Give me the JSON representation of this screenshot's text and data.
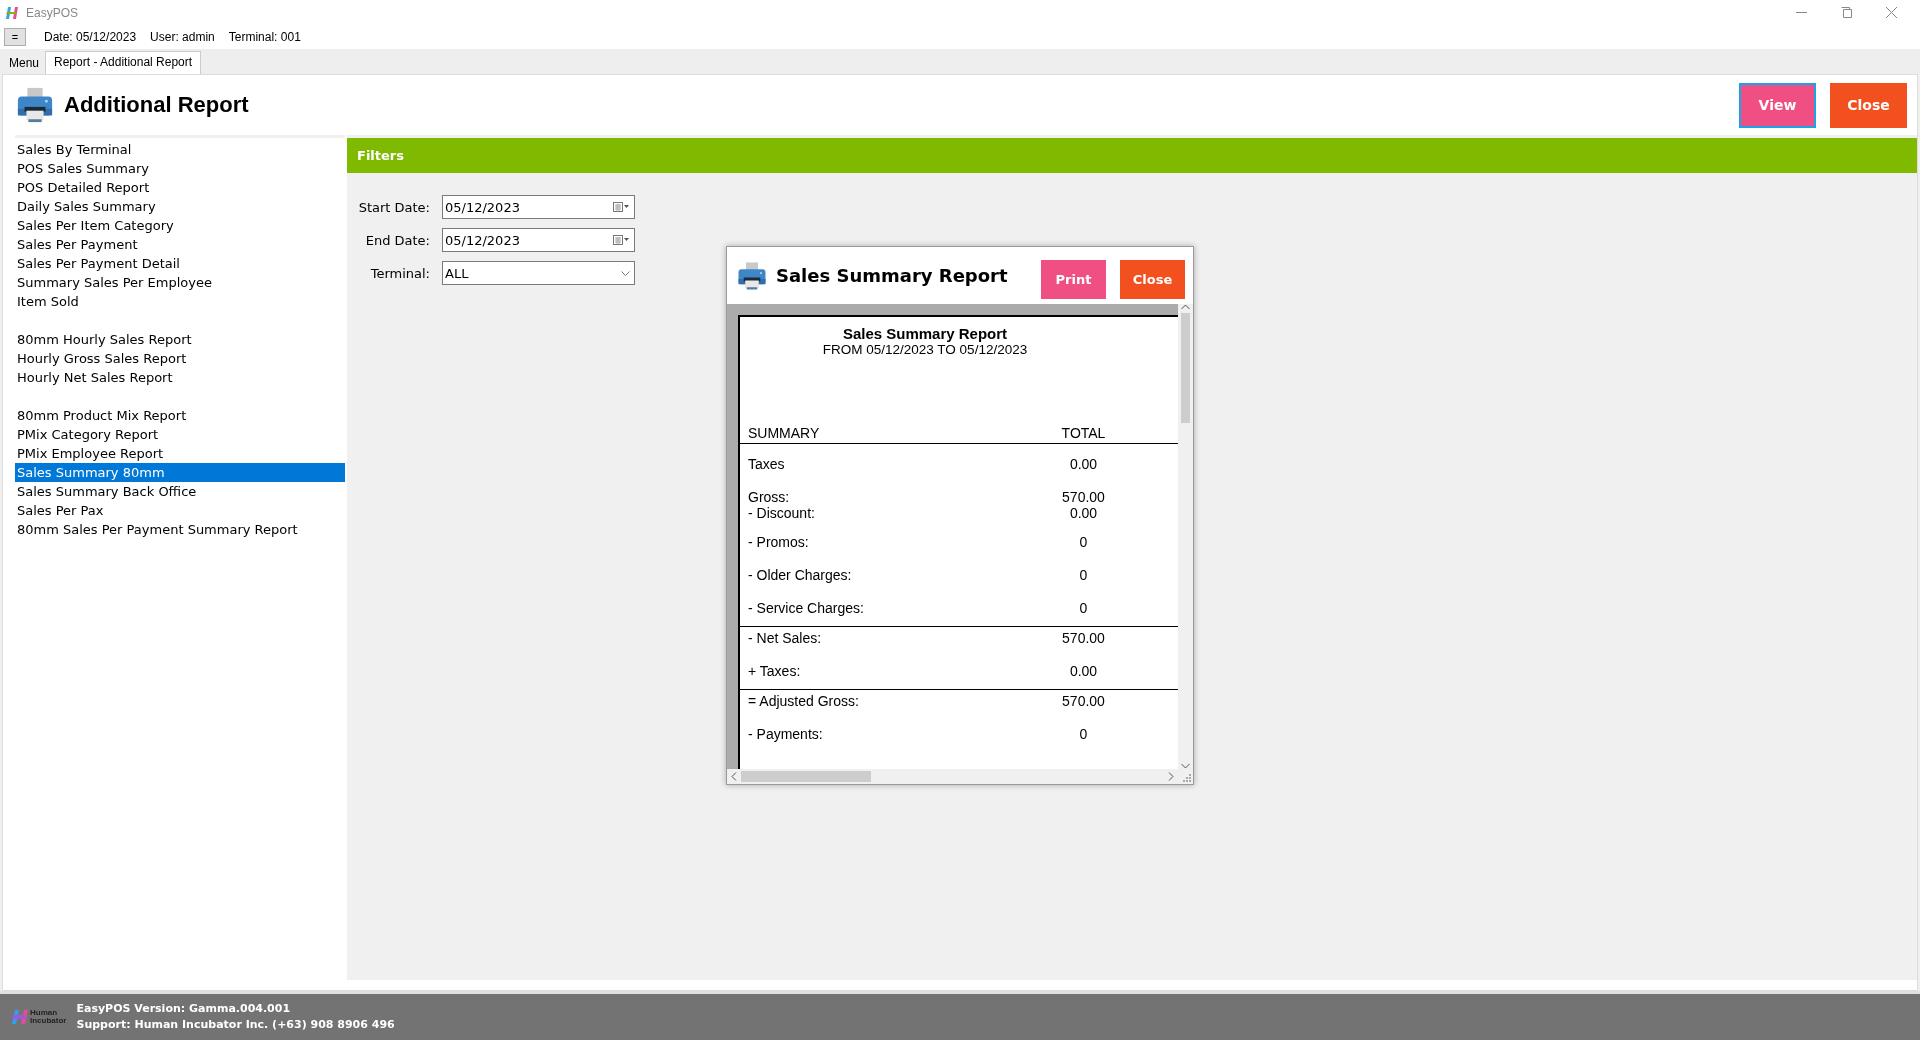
{
  "window": {
    "title": "EasyPOS"
  },
  "info_bar": {
    "menu_button": "=",
    "date": "Date: 05/12/2023",
    "user": "User: admin",
    "terminal": "Terminal: 001"
  },
  "tabs": [
    {
      "label": "Menu",
      "selected": false
    },
    {
      "label": "Report - Additional Report",
      "selected": true
    }
  ],
  "page": {
    "title": "Additional Report",
    "buttons": [
      {
        "label": "View",
        "kind": "view",
        "focused": true
      },
      {
        "label": "Close",
        "kind": "close",
        "focused": false
      }
    ]
  },
  "report_list": [
    [
      {
        "label": "Sales By Terminal",
        "selected": false
      },
      {
        "label": "POS Sales Summary",
        "selected": false
      },
      {
        "label": "POS Detailed Report",
        "selected": false
      },
      {
        "label": "Daily Sales Summary",
        "selected": false
      },
      {
        "label": "Sales Per Item Category",
        "selected": false
      },
      {
        "label": "Sales Per Payment",
        "selected": false
      },
      {
        "label": "Sales Per Payment Detail",
        "selected": false
      },
      {
        "label": "Summary Sales Per Employee",
        "selected": false
      },
      {
        "label": "Item Sold",
        "selected": false
      }
    ],
    [
      {
        "label": "80mm Hourly Sales Report",
        "selected": false
      },
      {
        "label": "Hourly Gross Sales Report",
        "selected": false
      },
      {
        "label": "Hourly Net Sales Report",
        "selected": false
      }
    ],
    [
      {
        "label": "80mm Product Mix Report",
        "selected": false
      },
      {
        "label": "PMix Category Report",
        "selected": false
      },
      {
        "label": "PMix Employee Report",
        "selected": false
      },
      {
        "label": "Sales Summary 80mm",
        "selected": true
      },
      {
        "label": "Sales Summary Back Office",
        "selected": false
      },
      {
        "label": "Sales Per Pax",
        "selected": false
      },
      {
        "label": "80mm Sales Per Payment Summary Report",
        "selected": false
      }
    ]
  ],
  "filters": {
    "title": "Filters",
    "fields": [
      {
        "label": "Start Date:",
        "value": "05/12/2023",
        "kind": "date"
      },
      {
        "label": "End Date:",
        "value": "05/12/2023",
        "kind": "date"
      },
      {
        "label": "Terminal:",
        "value": "ALL",
        "kind": "select"
      }
    ]
  },
  "dialog": {
    "title": "Sales Summary Report",
    "buttons": [
      {
        "label": "Print",
        "kind": "print"
      },
      {
        "label": "Close",
        "kind": "close"
      }
    ],
    "report": {
      "title": "Sales Summary Report",
      "subtitle": "FROM 05/12/2023 TO 05/12/2023",
      "columns": [
        "SUMMARY",
        "TOTAL"
      ],
      "rows": [
        {
          "rule_above": false,
          "lines": [
            {
              "label": "Taxes",
              "total": "0.00"
            }
          ]
        },
        {
          "rule_above": false,
          "lines": [
            {
              "label": "Gross:",
              "total": "570.00"
            },
            {
              "label": "- Discount:",
              "total": "0.00"
            }
          ]
        },
        {
          "rule_above": false,
          "lines": [
            {
              "label": "- Promos:",
              "total": "0"
            }
          ]
        },
        {
          "rule_above": false,
          "lines": [
            {
              "label": "- Older Charges:",
              "total": "0"
            }
          ]
        },
        {
          "rule_above": false,
          "lines": [
            {
              "label": "- Service Charges:",
              "total": "0"
            }
          ]
        },
        {
          "rule_above": true,
          "lines": [
            {
              "label": "- Net Sales:",
              "total": "570.00"
            }
          ]
        },
        {
          "rule_above": false,
          "lines": [
            {
              "label": "+ Taxes:",
              "total": "0.00"
            }
          ]
        },
        {
          "rule_above": true,
          "lines": [
            {
              "label": "= Adjusted Gross:",
              "total": "570.00"
            }
          ]
        },
        {
          "rule_above": false,
          "lines": [
            {
              "label": "- Payments:",
              "total": "0"
            }
          ]
        }
      ]
    }
  },
  "footer": {
    "logo_text": [
      "Human",
      "Incubator"
    ],
    "version": "EasyPOS Version: Gamma.004.001",
    "support": "Support: Human Incubator Inc. (+63) 908 8906 496"
  }
}
